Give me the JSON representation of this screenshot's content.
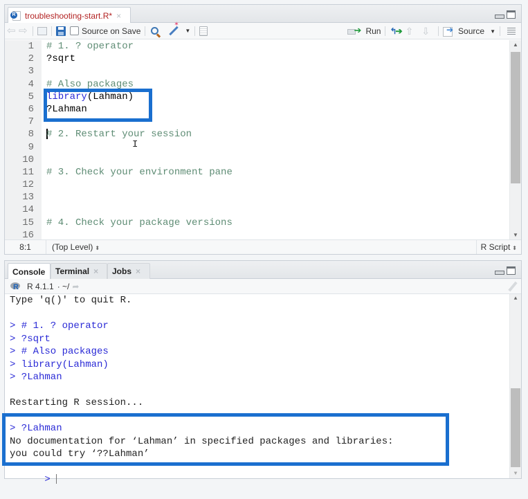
{
  "editor": {
    "tab": {
      "filename": "troubleshooting-start.R*",
      "close": "×"
    },
    "toolbar": {
      "source_on_save_label": "Source on Save",
      "source_on_save_checked": false,
      "run_label": "Run",
      "source_label": "Source"
    },
    "lines": [
      {
        "n": "1",
        "text": "# 1. ? operator",
        "type": "comment"
      },
      {
        "n": "2",
        "text": "?sqrt",
        "type": "code"
      },
      {
        "n": "3",
        "text": "",
        "type": "code"
      },
      {
        "n": "4",
        "text": "# Also packages",
        "type": "comment"
      },
      {
        "n": "5",
        "fn": "library",
        "rest": "(Lahman)",
        "type": "call"
      },
      {
        "n": "6",
        "text": "?Lahman",
        "type": "code"
      },
      {
        "n": "7",
        "text": "",
        "type": "code"
      },
      {
        "n": "8",
        "text": "# 2. Restart your session",
        "type": "comment",
        "cursor": true
      },
      {
        "n": "9",
        "text": "",
        "type": "code"
      },
      {
        "n": "10",
        "text": "",
        "type": "code"
      },
      {
        "n": "11",
        "text": "# 3. Check your environment pane",
        "type": "comment"
      },
      {
        "n": "12",
        "text": "",
        "type": "code"
      },
      {
        "n": "13",
        "text": "",
        "type": "code"
      },
      {
        "n": "14",
        "text": "",
        "type": "code"
      },
      {
        "n": "15",
        "text": "# 4. Check your package versions",
        "type": "comment"
      },
      {
        "n": "16",
        "text": "",
        "type": "code"
      }
    ],
    "status": {
      "position": "8:1",
      "scope": "(Top Level)",
      "file_type": "R Script"
    }
  },
  "console": {
    "tabs": [
      {
        "label": "Console",
        "closable": false
      },
      {
        "label": "Terminal",
        "closable": true
      },
      {
        "label": "Jobs",
        "closable": true
      }
    ],
    "close": "×",
    "r_version": "R 4.1.1",
    "working_dir": "· ~/",
    "lines": [
      {
        "text": "Type 'q()' to quit R.",
        "type": "output"
      },
      {
        "text": "",
        "type": "output"
      },
      {
        "text": "> # 1. ? operator",
        "type": "input"
      },
      {
        "text": "> ?sqrt",
        "type": "input"
      },
      {
        "text": "> # Also packages",
        "type": "input"
      },
      {
        "text": "> library(Lahman)",
        "type": "input"
      },
      {
        "text": "> ?Lahman",
        "type": "input"
      },
      {
        "text": "",
        "type": "output"
      },
      {
        "text": "Restarting R session...",
        "type": "output"
      },
      {
        "text": "",
        "type": "output"
      },
      {
        "text": "> ?Lahman",
        "type": "input"
      },
      {
        "text": "No documentation for ‘Lahman’ in specified packages and libraries:",
        "type": "output"
      },
      {
        "text": "you could try ‘??Lahman’",
        "type": "output"
      }
    ],
    "prompt": ">"
  },
  "colors": {
    "highlight": "#1a6fcf",
    "comment": "#5e8c74",
    "function": "#2a2ad6",
    "tab_modified": "#b22222"
  }
}
